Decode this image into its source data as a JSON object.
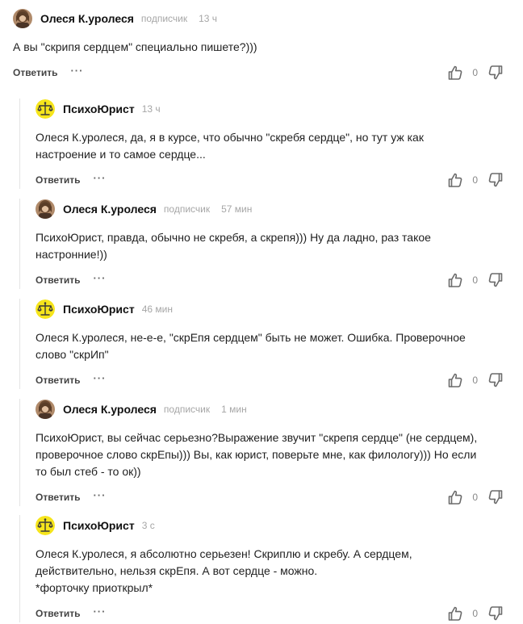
{
  "ui": {
    "reply_label": "Ответить",
    "more_label": "···",
    "subscriber_label": "подписчик"
  },
  "comments": [
    {
      "author": "Олеся К.уролеся",
      "badge": "подписчик",
      "time": "13 ч",
      "text": "А вы \"скрипя сердцем\" специально пишете?)))",
      "score": "0"
    },
    {
      "author": "ПсихоЮрист",
      "time": "13 ч",
      "text": "Олеся К.уролеся, да, я в курсе, что обычно \"скребя сердце\", но тут уж как\nнастроение и то самое сердце...",
      "score": "0"
    },
    {
      "author": "Олеся К.уролеся",
      "badge": "подписчик",
      "time": "57 мин",
      "text": "ПсихоЮрист, правда, обычно не скребя, а скрепя))) Ну да ладно, раз такое\nнастронние!))",
      "score": "0"
    },
    {
      "author": "ПсихоЮрист",
      "time": "46 мин",
      "text": "Олеся К.уролеся, не-е-е, \"скрЕпя сердцем\" быть не может. Ошибка. Проверочное\nслово \"скрИп\"",
      "score": "0"
    },
    {
      "author": "Олеся К.уролеся",
      "badge": "подписчик",
      "time": "1 мин",
      "text": "ПсихоЮрист, вы сейчас серьезно?Выражение звучит \"скрепя сердце\" (не сердцем),\nпроверочное слово скрЕпы))) Вы, как юрист, поверьте мне, как филологу))) Но если\nто был стеб - то ок))",
      "score": "0"
    },
    {
      "author": "ПсихоЮрист",
      "time": "3 с",
      "text": "Олеся К.уролеся, я абсолютно серьезен! Скриплю и скребу. А сердцем,\nдействительно, нельзя скрЕпя. А вот сердце - можно.\n*форточку приоткрыл*",
      "score": "0"
    }
  ],
  "icons": {
    "like": "thumb-up-icon",
    "dislike": "thumb-down-icon",
    "avatar_olesya": "woman-photo-avatar",
    "avatar_psycho": "scales-of-justice-avatar"
  },
  "colors": {
    "psycho_avatar_bg": "#f6e51c",
    "muted_text": "#a6a6a6",
    "thread_line": "#e4e4e4"
  }
}
